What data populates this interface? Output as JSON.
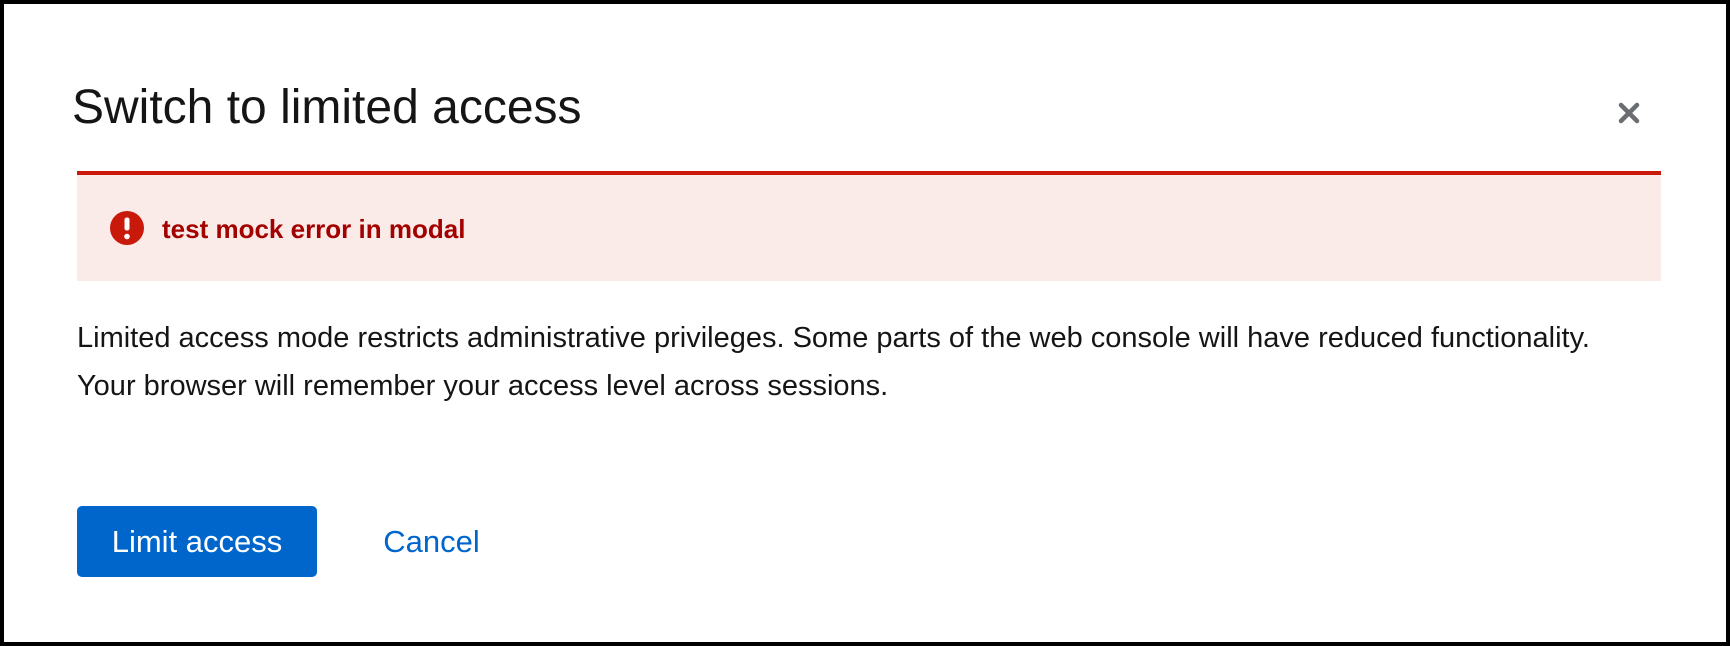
{
  "modal": {
    "title": "Switch to limited access",
    "close_icon": "close-icon"
  },
  "alert": {
    "icon": "exclamation-circle-icon",
    "message": "test mock error in modal",
    "accent_color": "#c9190b",
    "background_color": "#faeae8",
    "text_color": "#a30000"
  },
  "body": {
    "paragraph_1": "Limited access mode restricts administrative privileges. Some parts of the web console will have reduced functionality.",
    "paragraph_2": "Your browser will remember your access level across sessions."
  },
  "footer": {
    "primary_label": "Limit access",
    "primary_color": "#0066cc",
    "cancel_label": "Cancel"
  }
}
